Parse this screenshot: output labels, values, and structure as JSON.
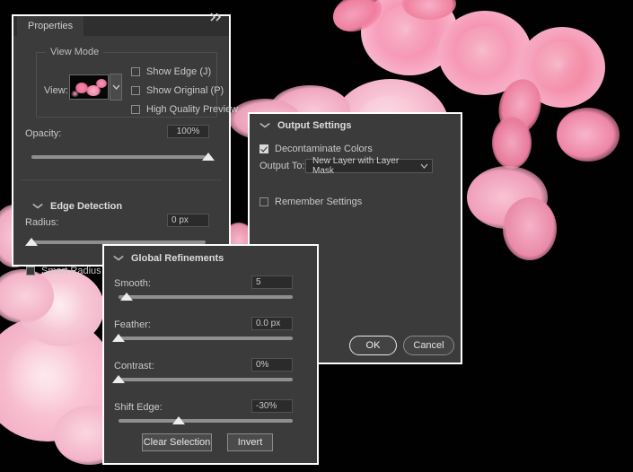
{
  "app": {
    "panel_bg": "#3b3b3b",
    "accent": "#ededed",
    "canvas_bg": "#000000"
  },
  "properties_panel": {
    "tab_label": "Properties",
    "collapse_icon": "collapse-panel-icon",
    "view_mode": {
      "group_title": "View Mode",
      "view_label": "View:",
      "thumbnail_alt": "view-preview-thumbnail",
      "dropdown_icon": "chevron-down-icon",
      "checkboxes": [
        {
          "label": "Show Edge (J)",
          "checked": false
        },
        {
          "label": "Show Original (P)",
          "checked": false
        },
        {
          "label": "High Quality Preview",
          "checked": false
        }
      ]
    },
    "opacity": {
      "label": "Opacity:",
      "value": "100%",
      "slider_percent": 100
    },
    "edge_detection": {
      "section_title": "Edge Detection",
      "chevron": "chevron-down-icon",
      "radius_label": "Radius:",
      "radius_value": "0 px",
      "radius_percent": 0,
      "smart_radius": {
        "label": "Smart Radius",
        "checked": false
      }
    }
  },
  "output_panel": {
    "section_title": "Output Settings",
    "chevron": "chevron-down-icon",
    "decontaminate": {
      "label": "Decontaminate Colors",
      "checked": true
    },
    "output_to": {
      "label": "Output To:",
      "value": "New Layer with Layer Mask",
      "dropdown_icon": "chevron-down-icon"
    },
    "remember": {
      "label": "Remember Settings",
      "checked": false
    },
    "buttons": {
      "ok": "OK",
      "cancel": "Cancel"
    }
  },
  "global_panel": {
    "section_title": "Global Refinements",
    "chevron": "chevron-down-icon",
    "sliders": [
      {
        "label": "Smooth:",
        "value": "5",
        "percent": 5
      },
      {
        "label": "Feather:",
        "value": "0.0 px",
        "percent": 0
      },
      {
        "label": "Contrast:",
        "value": "0%",
        "percent": 0
      },
      {
        "label": "Shift Edge:",
        "value": "-30%",
        "percent": 35
      }
    ],
    "buttons": {
      "clear_selection": "Clear Selection",
      "invert": "Invert"
    }
  }
}
